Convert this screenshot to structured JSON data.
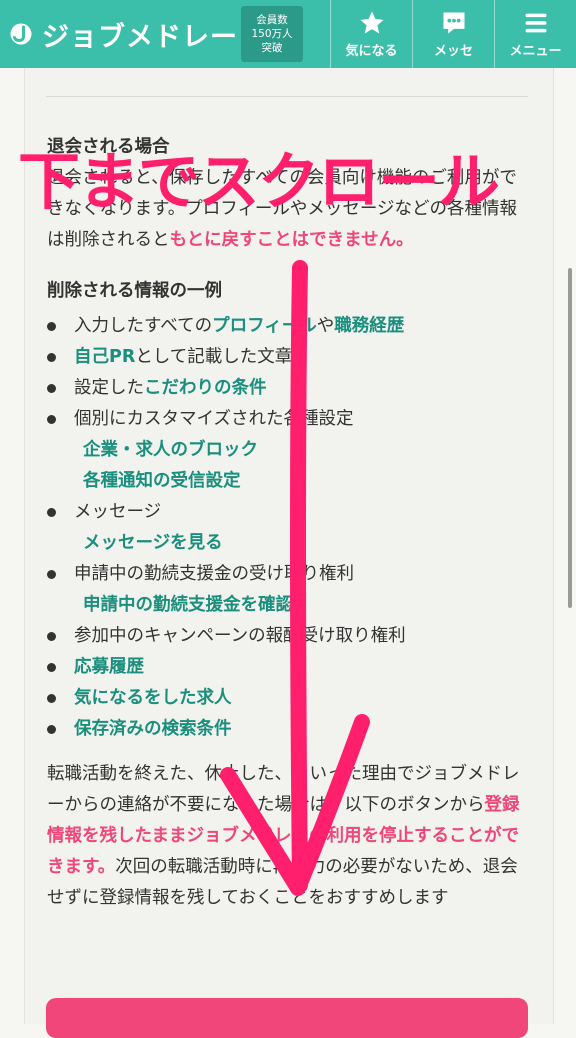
{
  "header": {
    "logo_text": "ジョブメドレー",
    "member_badge": [
      "会員数",
      "150万人",
      "突破"
    ],
    "nav": [
      {
        "label": "気になる",
        "icon": "star-icon"
      },
      {
        "label": "メッセ",
        "icon": "message-icon"
      },
      {
        "label": "メニュー",
        "icon": "menu-icon"
      }
    ]
  },
  "content": {
    "section_title": "退会される場合",
    "intro_1": "退会されると、保存したすべての会員向け機能のご利用ができなくなります。プロフィールやメッセージなどの各種情報は削除されると",
    "intro_em": "もとに戻すことはできません",
    "intro_end": "。",
    "list_title": "削除される情報の一例",
    "items": {
      "i1_pre": "入力したすべての",
      "i1_link1": "プロフィール",
      "i1_mid": "や",
      "i1_link2": "職務経歴",
      "i2_link": "自己PR",
      "i2_post": "として記載した文章",
      "i3_pre": "設定した",
      "i3_link": "こだわりの条件",
      "i4": "個別にカスタマイズされた各種設定",
      "i4_sub1": "企業・求人のブロック",
      "i4_sub2": "各種通知の受信設定",
      "i5": "メッセージ",
      "i5_sub": "メッセージを見る",
      "i6": "申請中の勤続支援金の受け取り権利",
      "i6_sub": "申請中の勤続支援金を確認",
      "i7": "参加中のキャンペーンの報酬受け取り権利",
      "i8": "応募履歴",
      "i9": "気になるをした求人",
      "i10": "保存済みの検索条件"
    },
    "outro_1": "転職活動を終えた、休止した、といった理由でジョブメドレーからの連絡が不要になった場合は、以下のボタンから",
    "outro_em": "登録情報を残したままジョブメドレーの利用を停止することができます。",
    "outro_2": "次回の転職活動時に再入力の必要がないため、退会せずに登録情報を残しておくことをおすすめします"
  },
  "overlay": {
    "text": "下までスクロール",
    "color": "#ff1f6d"
  },
  "colors": {
    "header": "#3bbfaa",
    "link": "#1a8f7d",
    "emphasis": "#f0467a"
  }
}
